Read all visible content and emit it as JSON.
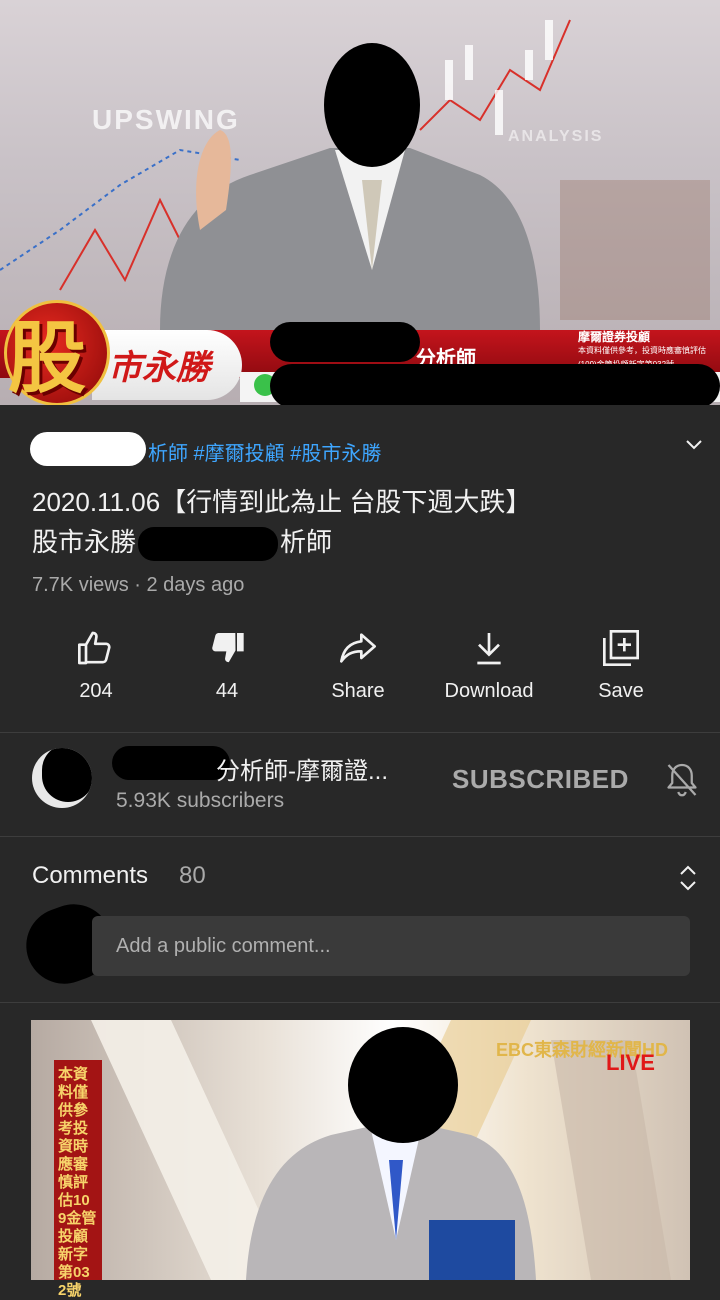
{
  "player": {
    "bg_left_text": "UPSWING",
    "bg_right_text": "ANALYSIS",
    "logo_big_char": "股",
    "logo_sub": "市永勝",
    "lower_third_title": "分析師",
    "brand_line1": "摩爾證券投顧",
    "brand_line2": "本資料僅供參考，投資時應審慎評估",
    "brand_line3": "(109)金管投顧新字第032號"
  },
  "video": {
    "hashtags": "析師 #摩爾投顧 #股市永勝",
    "title_line1": "2020.11.06【行情到此為止  台股下週大跌】",
    "title_line2_a": "股市永勝",
    "title_line2_b": "析師",
    "views": "7.7K views",
    "age": "2 days ago"
  },
  "actions": {
    "like_count": "204",
    "dislike_count": "44",
    "share_label": "Share",
    "download_label": "Download",
    "save_label": "Save"
  },
  "channel": {
    "name": "分析師-摩爾證...",
    "subscribers": "5.93K subscribers",
    "subscribed_label": "SUBSCRIBED"
  },
  "comments": {
    "heading": "Comments",
    "count": "80",
    "placeholder": "Add a public comment..."
  },
  "next_video": {
    "vertical_text": "本資料僅供參考投資時應審慎評估109金管投顧新字第032號",
    "network": "EBC東森財經新聞HD",
    "live": "LIVE"
  },
  "colors": {
    "background": "#282828",
    "link": "#3ea6ff",
    "secondary_text": "#aaaaaa",
    "live_red": "#e01818"
  }
}
